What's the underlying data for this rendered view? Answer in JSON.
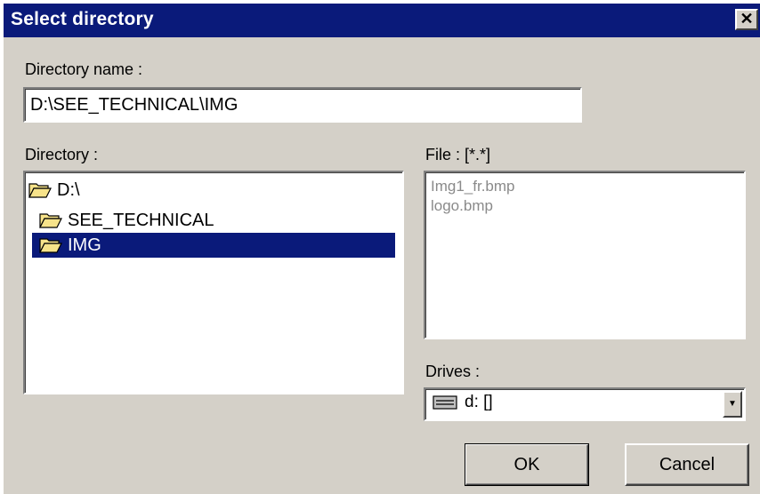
{
  "window": {
    "title": "Select directory",
    "close_glyph": "✕"
  },
  "directory_name": {
    "label": "Directory name :",
    "value": "D:\\SEE_TECHNICAL\\IMG"
  },
  "directory": {
    "label": "Directory :",
    "items": [
      {
        "label": "D:\\",
        "icon": "folder-open-icon",
        "selected": false
      },
      {
        "label": "SEE_TECHNICAL",
        "icon": "folder-open-icon",
        "selected": false
      },
      {
        "label": "IMG",
        "icon": "folder-open-icon",
        "selected": true
      }
    ]
  },
  "files": {
    "label": "File : [*.*]",
    "items": [
      "Img1_fr.bmp",
      "logo.bmp"
    ]
  },
  "drives": {
    "label": "Drives :",
    "selected": "d: []",
    "icon": "drive-icon",
    "dropdown_glyph": "▼"
  },
  "buttons": {
    "ok_label": "OK",
    "cancel_label": "Cancel"
  },
  "colors": {
    "titlebar": "#0a1a7a",
    "dialog_bg": "#d4d0c8",
    "selection": "#0a1a7a",
    "folder_fill": "#f7e38a"
  }
}
